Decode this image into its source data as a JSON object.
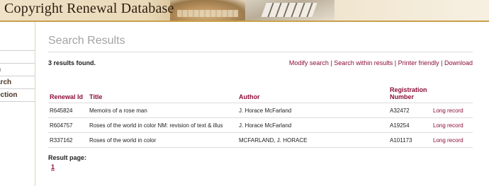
{
  "header": {
    "title": "Copyright Renewal Database"
  },
  "sidebar": {
    "items": [
      {
        "label": "n"
      },
      {
        "label": "arch"
      },
      {
        "label": "ection"
      }
    ]
  },
  "main": {
    "page_title": "Search Results",
    "results_count": "3 results found.",
    "links": {
      "modify": "Modify search",
      "within": "Search within results",
      "printer": "Printer friendly",
      "download": "Download",
      "sep": " | "
    },
    "table": {
      "headers": {
        "renewal_id": "Renewal Id",
        "title": "Title",
        "author": "Author",
        "registration": "Registration Number"
      },
      "rows": [
        {
          "renewal_id": "R645824",
          "title": "Memoirs of a rose man",
          "author": "J. Horace McFarland",
          "registration": "A32472",
          "link": "Long record"
        },
        {
          "renewal_id": "R604757",
          "title": "Roses of the world in color NM: revision of text & illus",
          "author": "J. Horace McFarland",
          "registration": "A19254",
          "link": "Long record"
        },
        {
          "renewal_id": "R337162",
          "title": "Roses of the world in color",
          "author": "MCFARLAND, J. HORACE",
          "registration": "A101173",
          "link": "Long record"
        }
      ]
    },
    "pagination": {
      "label": "Result page:",
      "current": "1"
    }
  },
  "colors": {
    "accent": "#8b0e3a",
    "header_rule": "#c9a04a"
  }
}
